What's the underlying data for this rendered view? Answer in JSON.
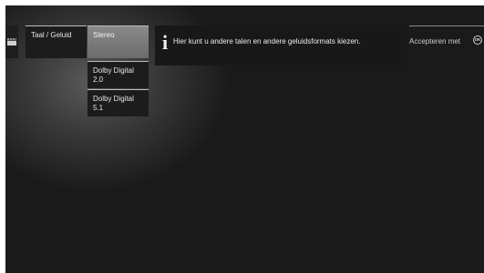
{
  "menu": {
    "category_icon": "film-clapper-icon",
    "category_label": "Taal / Geluid",
    "options": [
      {
        "label": "Stereo",
        "selected": true
      },
      {
        "label": "Dolby Digital 2.0",
        "selected": false
      },
      {
        "label": "Dolby Digital 5.1",
        "selected": false
      }
    ]
  },
  "info": {
    "icon": "info-icon",
    "text": "Hier kunt u andere talen en andere geluidsformats kiezen."
  },
  "hint": {
    "label": "Accepteren met",
    "button_icon": "ok-button-icon",
    "button_text": "OK"
  }
}
